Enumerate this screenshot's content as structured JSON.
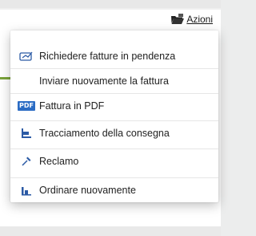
{
  "actions": {
    "label": "Azioni",
    "icon": "folder-open-icon"
  },
  "menu": {
    "items": [
      {
        "label": "Richiedere fatture in pendenza",
        "icon": "invoice-request-icon"
      },
      {
        "label": "Inviare nuovamente la fattura",
        "icon": ""
      },
      {
        "label": "Fattura in PDF",
        "icon": "pdf-icon",
        "badge": "PDF"
      },
      {
        "label": "Tracciamento della consegna",
        "icon": "tracking-icon"
      },
      {
        "label": "Reclamo",
        "icon": "pin-icon"
      },
      {
        "label": "Ordinare nuovamente",
        "icon": "reorder-icon"
      }
    ]
  },
  "colors": {
    "accent": "#2b6cc4",
    "green": "#7aa33a"
  }
}
